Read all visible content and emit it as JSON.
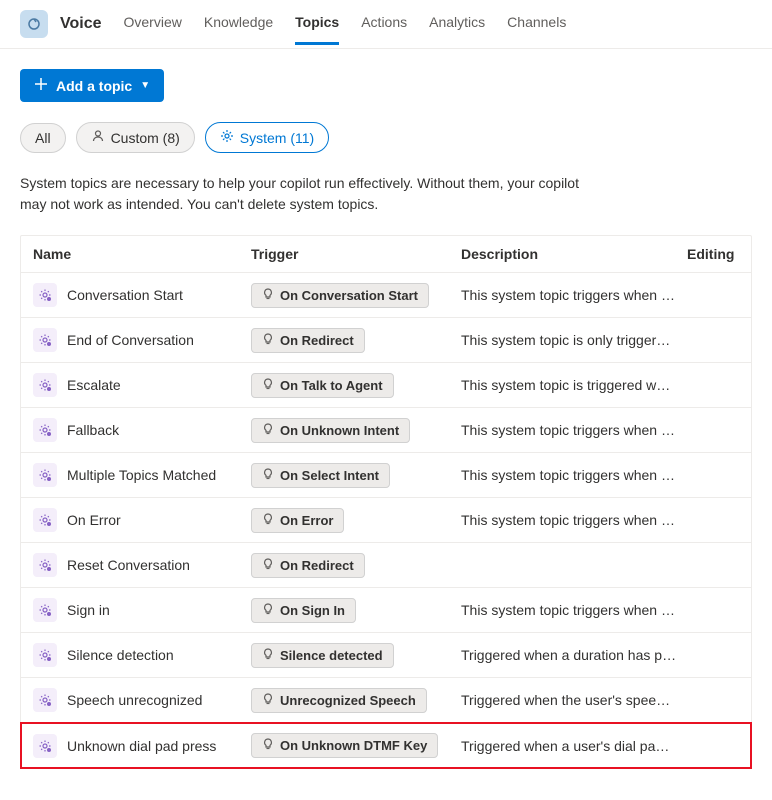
{
  "app": {
    "title": "Voice"
  },
  "nav": {
    "items": [
      {
        "label": "Overview"
      },
      {
        "label": "Knowledge"
      },
      {
        "label": "Topics"
      },
      {
        "label": "Actions"
      },
      {
        "label": "Analytics"
      },
      {
        "label": "Channels"
      }
    ]
  },
  "toolbar": {
    "add_label": "Add a topic"
  },
  "filters": {
    "all": "All",
    "custom": "Custom (8)",
    "system": "System (11)"
  },
  "info": "System topics are necessary to help your copilot run effectively. Without them, your copilot may not work as intended. You can't delete system topics.",
  "columns": {
    "name": "Name",
    "trigger": "Trigger",
    "description": "Description",
    "editing": "Editing"
  },
  "rows": [
    {
      "name": "Conversation Start",
      "trigger": "On Conversation Start",
      "desc": "This system topic triggers when the b…"
    },
    {
      "name": "End of Conversation",
      "trigger": "On Redirect",
      "desc": "This system topic is only triggered by …"
    },
    {
      "name": "Escalate",
      "trigger": "On Talk to Agent",
      "desc": "This system topic is triggered when t…"
    },
    {
      "name": "Fallback",
      "trigger": "On Unknown Intent",
      "desc": "This system topic triggers when the u…"
    },
    {
      "name": "Multiple Topics Matched",
      "trigger": "On Select Intent",
      "desc": "This system topic triggers when the b…"
    },
    {
      "name": "On Error",
      "trigger": "On Error",
      "desc": "This system topic triggers when the b…"
    },
    {
      "name": "Reset Conversation",
      "trigger": "On Redirect",
      "desc": ""
    },
    {
      "name": "Sign in",
      "trigger": "On Sign In",
      "desc": "This system topic triggers when the b…"
    },
    {
      "name": "Silence detection",
      "trigger": "Silence detected",
      "desc": "Triggered when a duration has passe…"
    },
    {
      "name": "Speech unrecognized",
      "trigger": "Unrecognized Speech",
      "desc": "Triggered when the user's speech inp…"
    },
    {
      "name": "Unknown dial pad press",
      "trigger": "On Unknown DTMF Key",
      "desc": "Triggered when a user's dial pad inpu…",
      "highlight": true
    }
  ]
}
